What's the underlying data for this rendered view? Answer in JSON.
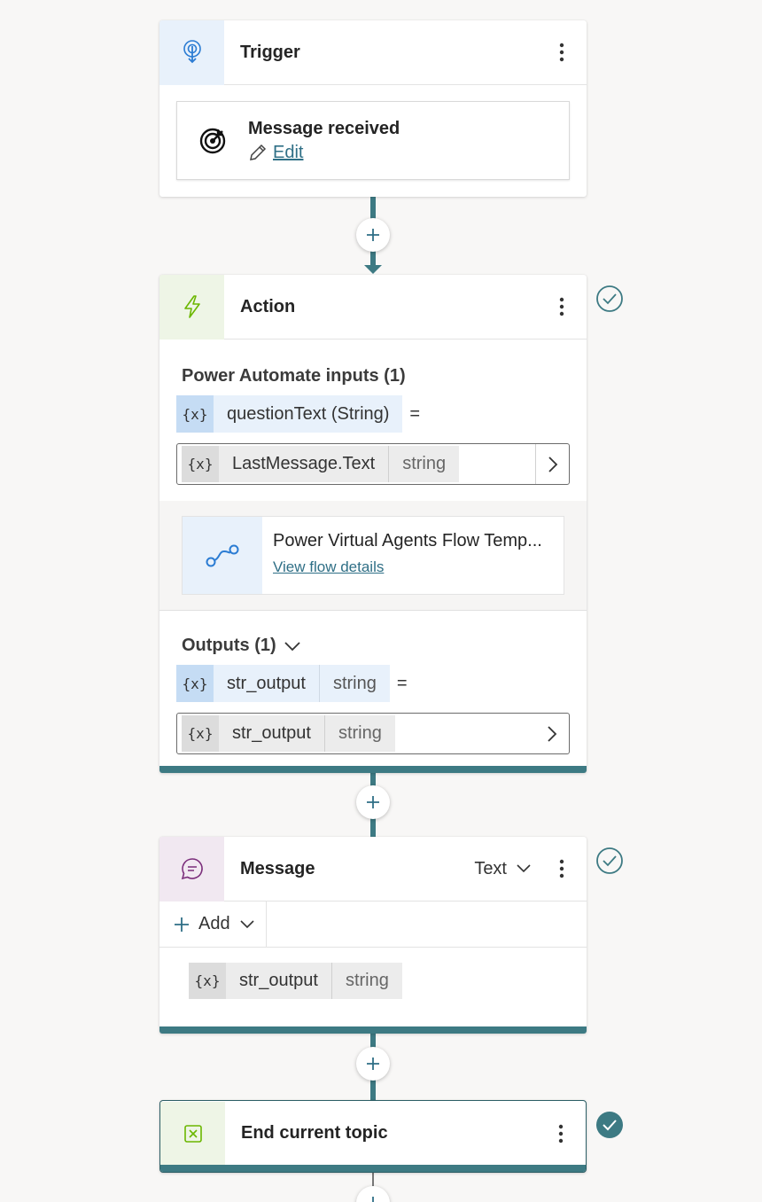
{
  "trigger": {
    "title": "Trigger",
    "event_title": "Message received",
    "edit_label": "Edit"
  },
  "action": {
    "title": "Action",
    "inputs_title": "Power Automate inputs (1)",
    "input_var_name": "questionText (String)",
    "equals": "=",
    "input_value_name": "LastMessage.Text",
    "input_value_type": "string",
    "flow_title": "Power Virtual Agents Flow Temp...",
    "flow_link": "View flow details",
    "outputs_title": "Outputs (1)",
    "output_var_name": "str_output",
    "output_var_type": "string",
    "output_value_name": "str_output",
    "output_value_type": "string"
  },
  "message": {
    "title": "Message",
    "format": "Text",
    "add_label": "Add",
    "var_name": "str_output",
    "var_type": "string"
  },
  "end": {
    "title": "End current topic"
  },
  "var_glyph": "{x}",
  "colors": {
    "accent": "#3d7a83",
    "link": "#2f6f86",
    "trigger_icon": "#2b7cd3",
    "action_icon": "#6bb700",
    "message_icon": "#7b2e7b"
  }
}
